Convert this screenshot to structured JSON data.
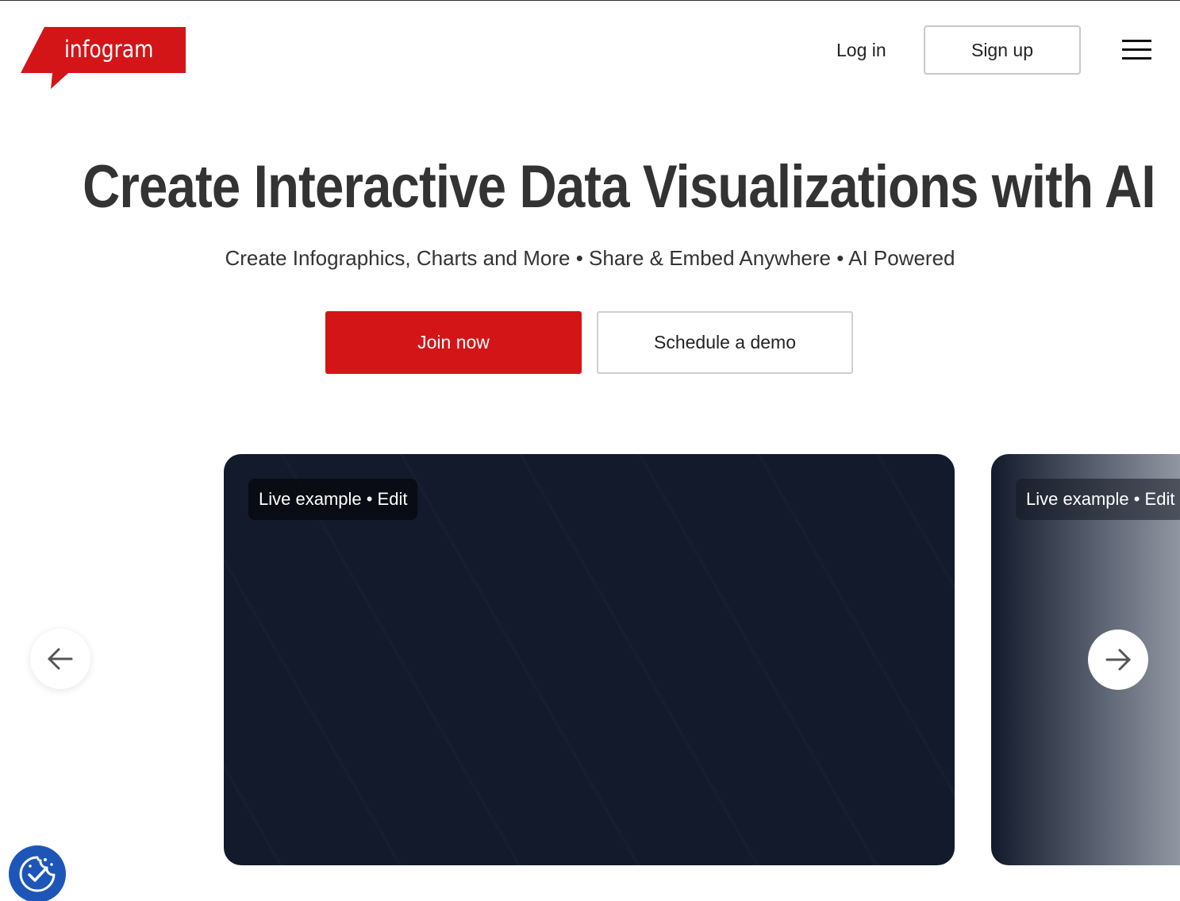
{
  "header": {
    "logo_text": "infogram",
    "login_label": "Log in",
    "signup_label": "Sign up",
    "menu_icon": "hamburger-icon"
  },
  "hero": {
    "title": "Create Interactive Data Visualizations with AI",
    "subtitle": "Create Infographics, Charts and More • Share & Embed Anywhere • AI Powered",
    "join_label": "Join now",
    "demo_label": "Schedule a demo"
  },
  "carousel": {
    "slides": [
      {
        "badge": "Live example • Edit"
      },
      {
        "badge": "Live example • Edit"
      }
    ],
    "prev_icon": "arrow-left-icon",
    "next_icon": "arrow-right-icon"
  },
  "cookie": {
    "icon": "cookie-consent-icon"
  },
  "colors": {
    "brand_red": "#d31518",
    "slide_bg": "#121a2b",
    "cookie_blue": "#1d56b8"
  }
}
